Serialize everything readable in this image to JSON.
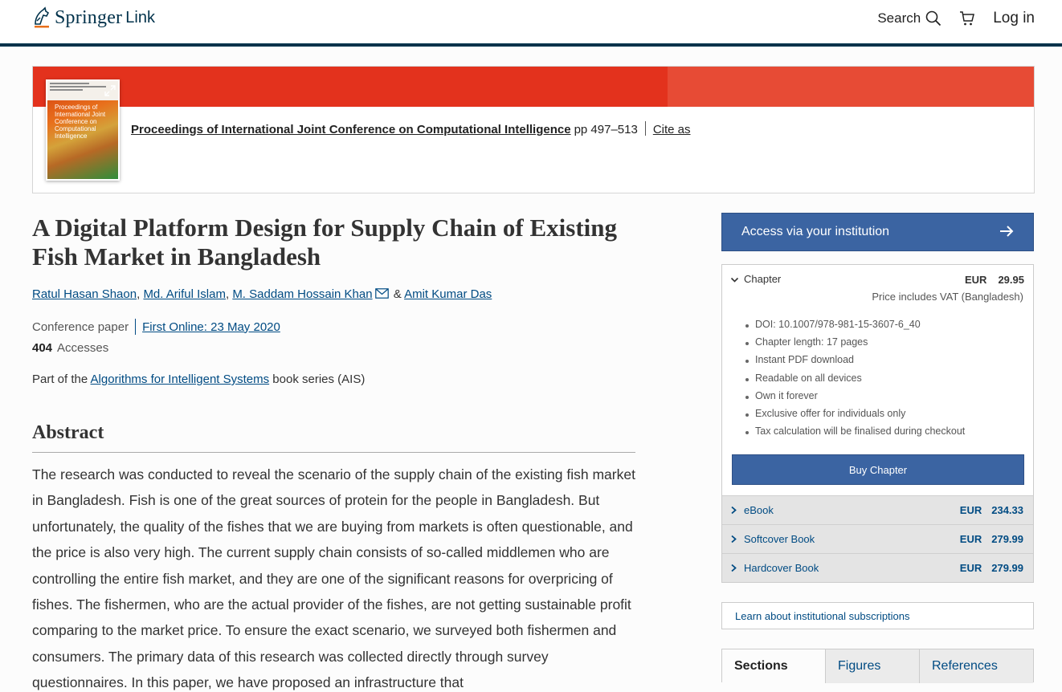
{
  "header": {
    "logo_springer": "Springer",
    "logo_link": "Link",
    "search_label": "Search",
    "login_label": "Log in"
  },
  "book": {
    "cover_title": "Proceedings of International Joint Conference on Computational Intelligence",
    "title": "Proceedings of International Joint Conference on Computational Intelligence",
    "pages": "pp 497–513",
    "cite_label": "Cite as"
  },
  "article": {
    "title": "A Digital Platform Design for Supply Chain of Existing Fish Market in Bangladesh",
    "authors": [
      {
        "name": "Ratul Hasan Shaon",
        "sep": ", "
      },
      {
        "name": "Md. Ariful Islam",
        "sep": ", "
      },
      {
        "name": "M. Saddam Hossain Khan",
        "sep": " & "
      },
      {
        "name": "Amit Kumar Das",
        "sep": ""
      }
    ],
    "type": "Conference paper",
    "first_online": "First Online: 23 May 2020",
    "accesses_count": "404",
    "accesses_label": "Accesses",
    "part_of_prefix": "Part of the ",
    "series_link": "Algorithms for Intelligent Systems",
    "part_of_suffix": " book series (AIS)",
    "abstract_heading": "Abstract",
    "abstract_text": "The research was conducted to reveal the scenario of the supply chain of the existing fish market in Bangladesh. Fish is one of the great sources of protein for the people in Bangladesh. But unfortunately, the quality of the fishes that we are buying from markets is often questionable, and the price is also very high. The current supply chain consists of so-called middlemen who are controlling the entire fish market, and they are one of the significant reasons for overpricing of fishes. The fishermen, who are the actual provider of the fishes, are not getting sustainable profit comparing to the market price. To ensure the exact scenario, we surveyed both fishermen and consumers. The primary data of this research was collected directly through survey questionnaires. In this paper, we have proposed an infrastructure that"
  },
  "sidebar": {
    "access_label": "Access via your institution",
    "chapter_label": "Chapter",
    "chapter_currency": "EUR",
    "chapter_price": "29.95",
    "vat_note": "Price includes VAT (Bangladesh)",
    "features": [
      "DOI: 10.1007/978-981-15-3607-6_40",
      "Chapter length: 17 pages",
      "Instant PDF download",
      "Readable on all devices",
      "Own it forever",
      "Exclusive offer for individuals only",
      "Tax calculation will be finalised during checkout"
    ],
    "buy_label": "Buy Chapter",
    "options": [
      {
        "label": "eBook",
        "currency": "EUR",
        "price": "234.33"
      },
      {
        "label": "Softcover Book",
        "currency": "EUR",
        "price": "279.99"
      },
      {
        "label": "Hardcover Book",
        "currency": "EUR",
        "price": "279.99"
      }
    ],
    "learn_label": "Learn about institutional subscriptions",
    "tabs": [
      "Sections",
      "Figures",
      "References"
    ]
  },
  "colors": {
    "brand_navy": "#01324b",
    "banner_red": "#e3321d",
    "button_blue": "#3b64a2",
    "link_blue": "#004b83"
  }
}
